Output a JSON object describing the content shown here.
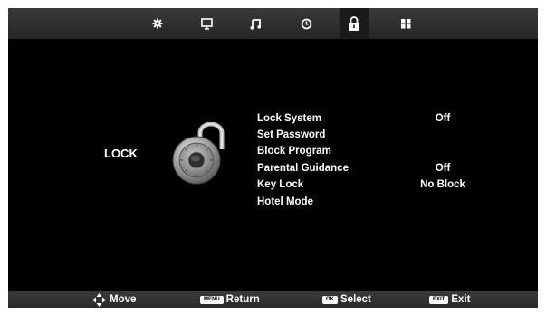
{
  "menu": {
    "tabs": [
      {
        "icon": "gear-icon"
      },
      {
        "icon": "monitor-icon"
      },
      {
        "icon": "music-note-icon"
      },
      {
        "icon": "clock-icon"
      },
      {
        "icon": "lock-icon",
        "active": true
      },
      {
        "icon": "app-grid-icon"
      }
    ],
    "title": "LOCK",
    "items": [
      {
        "label": "Lock System",
        "value": "Off"
      },
      {
        "label": "Set Password",
        "value": ""
      },
      {
        "label": "Block Program",
        "value": ""
      },
      {
        "label": "Parental Guidance",
        "value": "Off"
      },
      {
        "label": "Key Lock",
        "value": "No Block"
      },
      {
        "label": "Hotel Mode",
        "value": ""
      }
    ]
  },
  "footer": {
    "move_label": "Move",
    "menu_key": "MENU",
    "return_label": "Return",
    "ok_key": "OK",
    "select_label": "Select",
    "exit_key": "EXIT",
    "exit_label": "Exit"
  },
  "colors": {
    "background": "#000000",
    "bar": "#333333",
    "text": "#ffffff"
  }
}
